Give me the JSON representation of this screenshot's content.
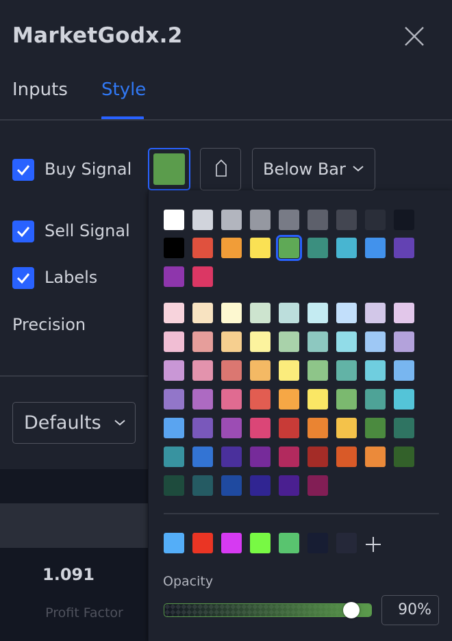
{
  "dialog": {
    "title": "MarketGodx.2",
    "tabs": [
      {
        "label": "Inputs",
        "active": false
      },
      {
        "label": "Style",
        "active": true
      }
    ],
    "rows": {
      "buy_signal": {
        "label": "Buy Signal",
        "checked": true
      },
      "sell_signal": {
        "label": "Sell Signal",
        "checked": true
      },
      "labels": {
        "label": "Labels",
        "checked": true
      },
      "precision_label": "Precision"
    },
    "buy_signal_color": "#5b9c4c",
    "location_select": "Below Bar",
    "defaults_button": "Defaults"
  },
  "background_stats": {
    "value": "1.091",
    "label": "Profit Factor"
  },
  "color_picker": {
    "selected_color": "#5b9c4c",
    "grays": [
      "#ffffff",
      "#d1d4dc",
      "#b2b5be",
      "#9598a1",
      "#787b86",
      "#5d606b",
      "#434651",
      "#2a2e39",
      "#131722"
    ],
    "primary": [
      "#000000",
      "#f23645",
      "#ff9800",
      "#ffeb3b",
      "#4caf50",
      "#089981",
      "#00bcd4",
      "#2962ff",
      "#673ab7",
      "#9c27b0",
      "#e91e63"
    ],
    "primary_display": [
      "#000000",
      "#e0513e",
      "#f19d38",
      "#fae154",
      "#5fa956",
      "#3b8f7f",
      "#48b5d1",
      "#4292ec",
      "#6342b3",
      "#8e36ac",
      "#db3764"
    ],
    "shades": [
      [
        "#f7d3dc",
        "#f8e3c1",
        "#fdf8d0",
        "#cde4cf",
        "#bcdedc",
        "#c4ebf2",
        "#c2dffb",
        "#d2c7e8",
        "#e2c7ea"
      ],
      [
        "#f1bed4",
        "#e69e9b",
        "#f6cf8f",
        "#fcf39e",
        "#a9d2aa",
        "#8dc8c0",
        "#91dce8",
        "#9ec8f5",
        "#b3a2db"
      ],
      [
        "#c997d6",
        "#e393ad",
        "#db7771",
        "#f4b964",
        "#fbec7c",
        "#8ec589",
        "#62b3a6",
        "#6fcedf",
        "#78b6f0"
      ],
      [
        "#9276c9",
        "#ad6ac2",
        "#e06b91",
        "#e25d51",
        "#f6a745",
        "#fae765",
        "#7bb96f",
        "#4ea397",
        "#54c4d8"
      ],
      [
        "#5aa4f0",
        "#7958bb",
        "#9c4db4",
        "#db4677",
        "#c83b37",
        "#ea8432",
        "#f4c24a",
        "#4b8a3f",
        "#2f7462"
      ],
      [
        "#3893a0",
        "#3374d4",
        "#4a309c",
        "#762b9a",
        "#b22a5e",
        "#a42c27",
        "#d95a28",
        "#eb8a3a",
        "#33612a"
      ],
      [
        "#1e4b3d",
        "#255b63",
        "#1f4aa0",
        "#302592",
        "#4a1f90",
        "#821e55"
      ]
    ],
    "custom": [
      "#54aef8",
      "#ea3524",
      "#d63af2",
      "#78f944",
      "#59c46f",
      "#171d33",
      "#252839"
    ],
    "add_custom": "+",
    "opacity_label": "Opacity",
    "opacity_value": "90%",
    "opacity_fraction": 0.9
  }
}
